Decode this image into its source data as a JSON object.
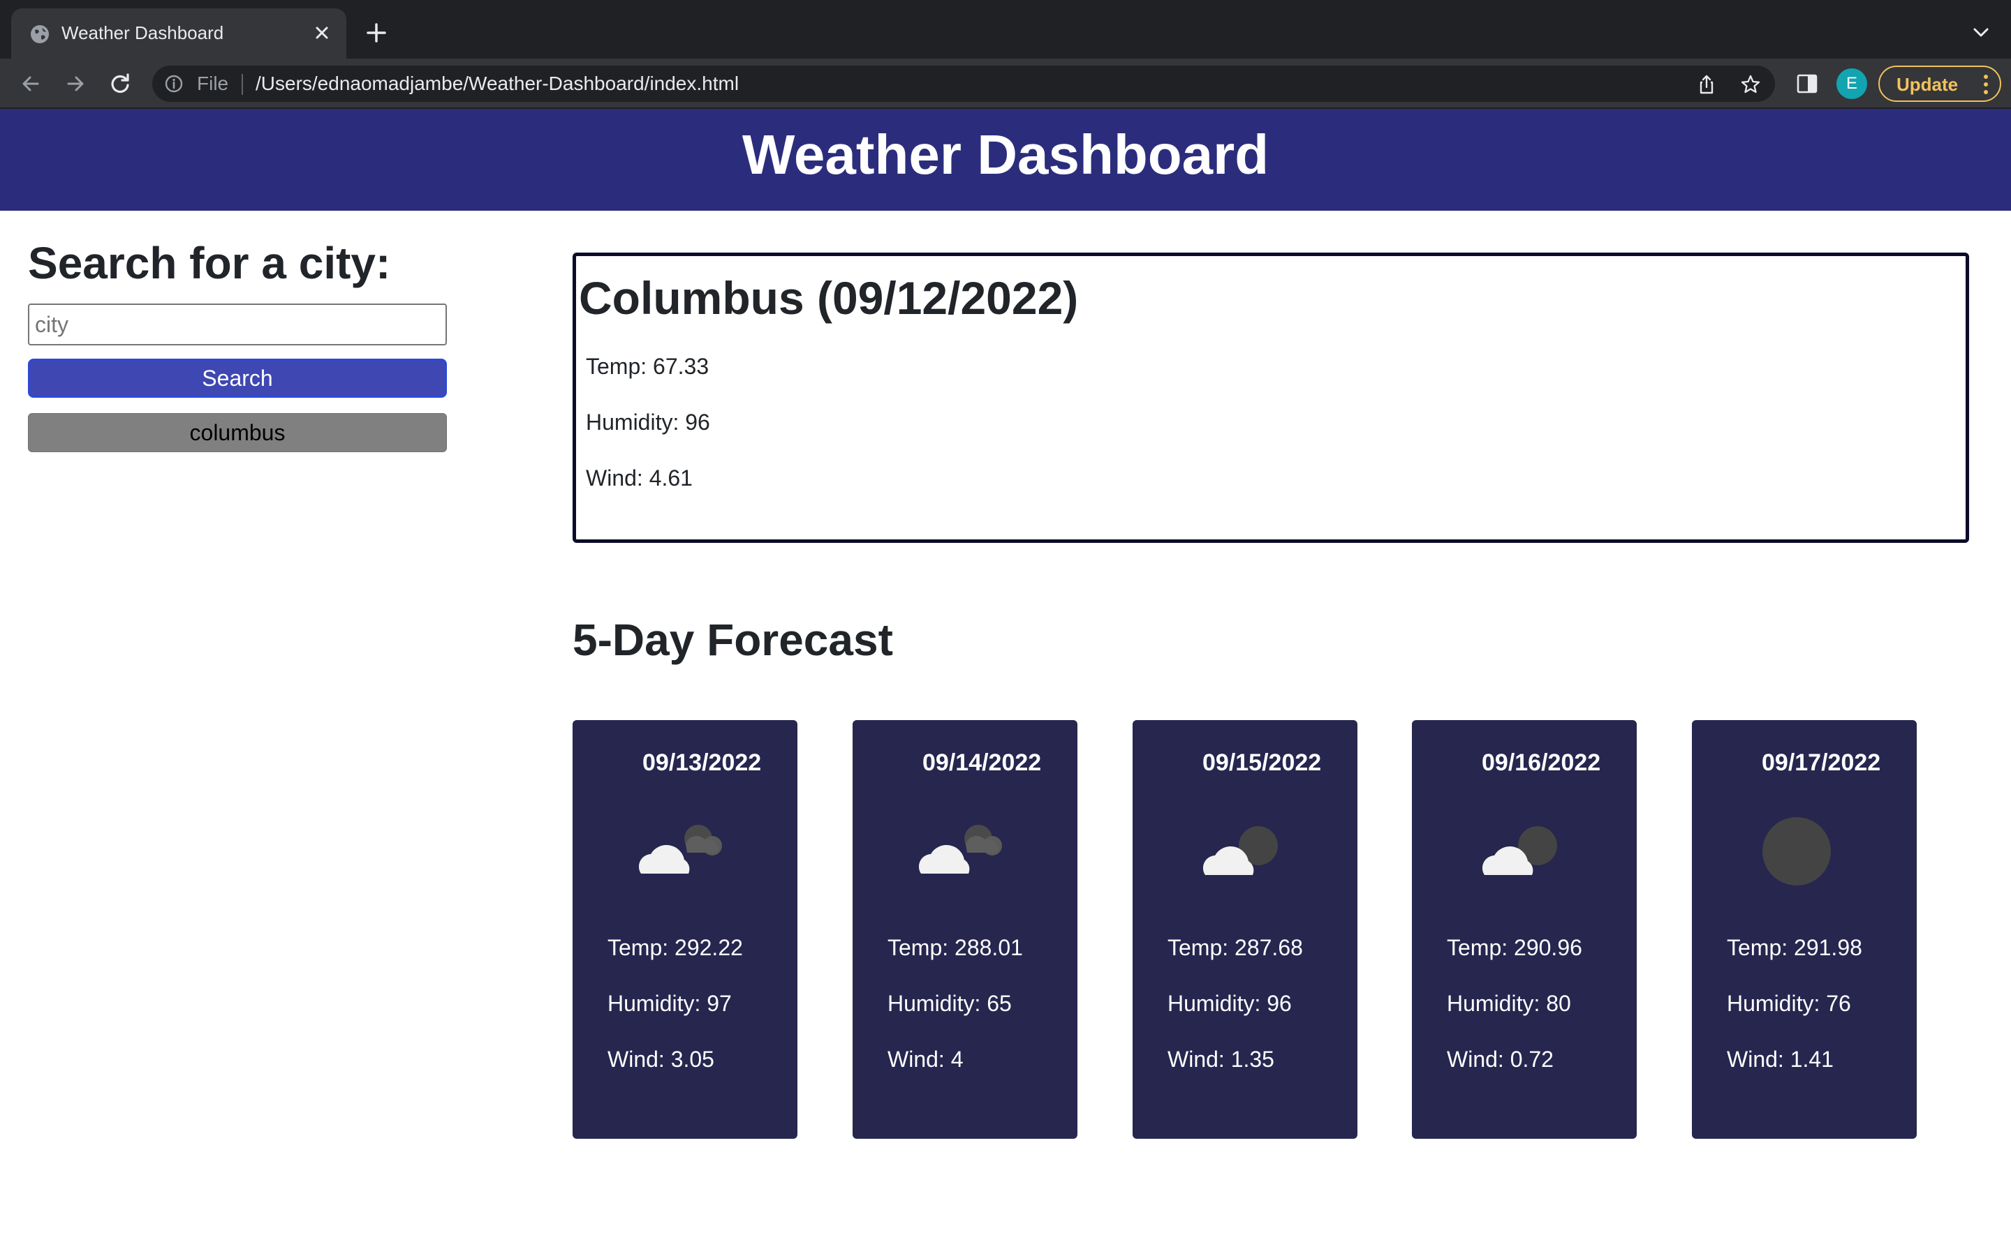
{
  "browser": {
    "tab_title": "Weather Dashboard",
    "scheme_label": "File",
    "url": "/Users/ednaomadjambe/Weather-Dashboard/index.html",
    "profile_initial": "E",
    "update_label": "Update"
  },
  "header": {
    "title": "Weather Dashboard"
  },
  "sidebar": {
    "heading": "Search for a city:",
    "input_placeholder": "city",
    "input_value": "",
    "search_label": "Search",
    "history": [
      "columbus"
    ]
  },
  "current": {
    "title": "Columbus (09/12/2022)",
    "temp": "Temp: 67.33",
    "humidity": "Humidity: 96",
    "wind": "Wind: 4.61"
  },
  "forecast": {
    "heading": "5-Day Forecast",
    "days": [
      {
        "date": "09/13/2022",
        "icon": "broken-clouds-night-icon",
        "temp": "Temp: 292.22",
        "humidity": "Humidity: 97",
        "wind": "Wind: 3.05"
      },
      {
        "date": "09/14/2022",
        "icon": "broken-clouds-night-icon",
        "temp": "Temp: 288.01",
        "humidity": "Humidity: 65",
        "wind": "Wind: 4"
      },
      {
        "date": "09/15/2022",
        "icon": "few-clouds-night-icon",
        "temp": "Temp: 287.68",
        "humidity": "Humidity: 96",
        "wind": "Wind: 1.35"
      },
      {
        "date": "09/16/2022",
        "icon": "few-clouds-night-icon",
        "temp": "Temp: 290.96",
        "humidity": "Humidity: 80",
        "wind": "Wind: 0.72"
      },
      {
        "date": "09/17/2022",
        "icon": "clear-night-icon",
        "temp": "Temp: 291.98",
        "humidity": "Humidity: 76",
        "wind": "Wind: 1.41"
      }
    ]
  },
  "colors": {
    "header_bg": "#2b2d7c",
    "card_bg": "#26264f",
    "search_btn": "#3f47b3",
    "history_btn": "#808080",
    "update_accent": "#f2c25b"
  }
}
